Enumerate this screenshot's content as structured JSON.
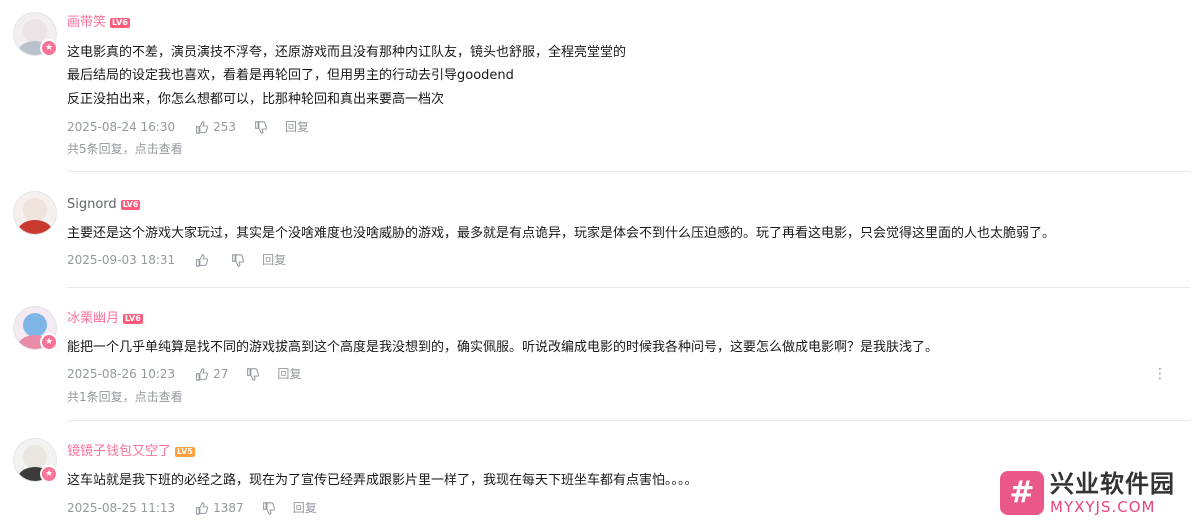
{
  "comments": [
    {
      "username": "画带笑",
      "level": "LV6",
      "lines": [
        "这电影真的不差，演员演技不浮夸，还原游戏而且没有那种内讧队友，镜头也舒服，全程亮堂堂的",
        "最后结局的设定我也喜欢，看着是再轮回了，但用男主的行动去引导goodend",
        "反正没拍出来，你怎么想都可以，比那种轮回和真出来要高一档次"
      ],
      "time": "2025-08-24 16:30",
      "likes": "253",
      "reply_label": "回复",
      "sub_replies": "共5条回复，点击查看"
    },
    {
      "username": "Signord",
      "level": "LV6",
      "lines": [
        "主要还是这个游戏大家玩过，其实是个没啥难度也没啥威胁的游戏，最多就是有点诡异，玩家是体会不到什么压迫感的。玩了再看这电影，只会觉得这里面的人也太脆弱了。"
      ],
      "time": "2025-09-03 18:31",
      "likes": "",
      "reply_label": "回复"
    },
    {
      "username": "冰栗幽月",
      "level": "LV6",
      "lines": [
        "能把一个几乎单纯算是找不同的游戏拔高到这个高度是我没想到的，确实佩服。听说改编成电影的时候我各种问号，这要怎么做成电影啊？是我肤浅了。"
      ],
      "time": "2025-08-26 10:23",
      "likes": "27",
      "reply_label": "回复",
      "sub_replies": "共1条回复，点击查看",
      "more_icon": "⋮"
    },
    {
      "username": "镜镜子钱包又空了",
      "level": "LV5",
      "lines": [
        "这车站就是我下班的必经之路，现在为了宣传已经弄成跟影片里一样了，我现在每天下班坐车都有点害怕。。。。"
      ],
      "time": "2025-08-25 11:13",
      "likes": "1387",
      "reply_label": "回复"
    }
  ],
  "watermark": {
    "logo_glyph": "#",
    "name": "兴业软件园",
    "domain": "MYXYJS.COM"
  },
  "colors": {
    "vip_pink": "#fb7299",
    "meta_gray": "#9499a0"
  }
}
